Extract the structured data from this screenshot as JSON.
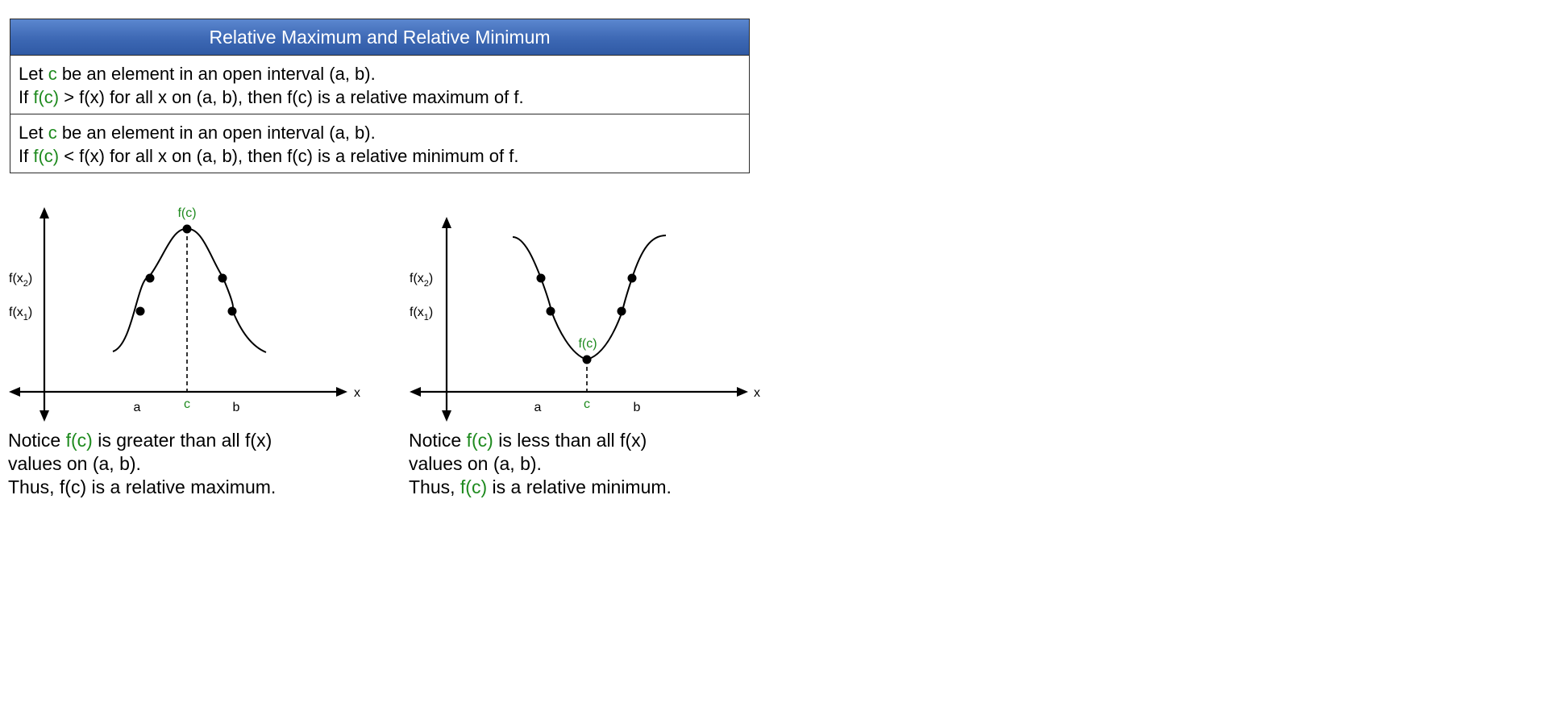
{
  "definition_table": {
    "title": "Relative Maximum and Relative Minimum",
    "max_row": {
      "line1_pre": "Let ",
      "line1_c": "c",
      "line1_post": " be an element in an open interval (a, b).",
      "line2_pre": "If ",
      "line2_fc": "f(c)",
      "line2_post": " > f(x) for all x on (a, b), then f(c) is a relative maximum of f."
    },
    "min_row": {
      "line1_pre": "Let ",
      "line1_c": "c",
      "line1_post": " be an element in an open interval (a, b).",
      "line2_pre": "If ",
      "line2_fc": "f(c)",
      "line2_post": " < f(x) for all x on (a, b), then f(c) is a relative minimum of f."
    }
  },
  "graph_labels": {
    "x_axis": "x",
    "a": "a",
    "b": "b",
    "c": "c",
    "fc": "f(c)",
    "fx2_base": "f(x",
    "fx2_sub": "2",
    "fx1_base": "f(x",
    "fx1_sub": "1",
    "paren_close": ")"
  },
  "captions": {
    "max": {
      "line1_pre": "Notice ",
      "line1_fc": "f(c)",
      "line1_post": " is greater than all f(x)",
      "line2": "values on (a, b).",
      "line3": "Thus, f(c) is a relative maximum."
    },
    "min": {
      "line1_pre": "Notice ",
      "line1_fc": "f(c)",
      "line1_post": " is less than all f(x)",
      "line2": "values on (a, b).",
      "line3_pre": "Thus, ",
      "line3_fc": "f(c)",
      "line3_post": " is a relative minimum."
    }
  },
  "colors": {
    "highlight": "#1e8a1e",
    "header_blue": "#3d68b4"
  }
}
